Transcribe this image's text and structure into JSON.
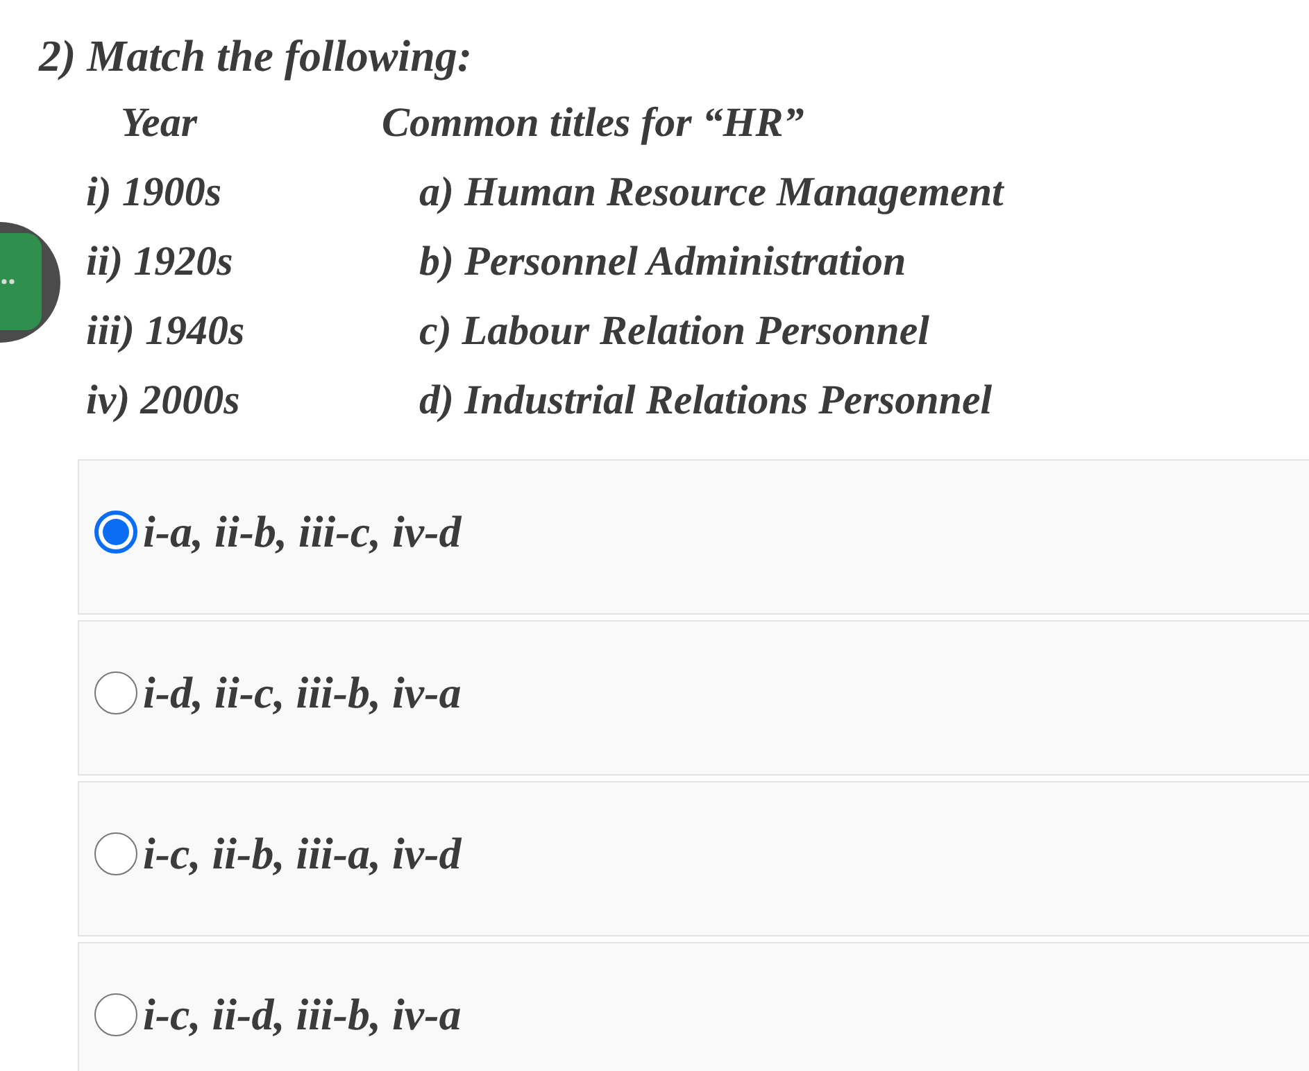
{
  "question": {
    "title": "2) Match the following:"
  },
  "columns": [
    {
      "heading": "Year",
      "items": [
        "i) 1900s",
        "ii) 1920s",
        "iii) 1940s",
        "iv) 2000s"
      ]
    },
    {
      "heading": "Common titles for “HR”",
      "items": [
        "a) Human Resource Management",
        "b) Personnel Administration",
        "c) Labour Relation Personnel",
        "d) Industrial Relations Personnel"
      ]
    }
  ],
  "options": [
    {
      "label": "i-a, ii-b, iii-c, iv-d",
      "selected": true
    },
    {
      "label": "i-d, ii-c, iii-b, iv-a",
      "selected": false
    },
    {
      "label": "i-c, ii-b, iii-a, iv-d",
      "selected": false
    },
    {
      "label": "i-c, ii-d, iii-b, iv-a",
      "selected": false
    }
  ]
}
